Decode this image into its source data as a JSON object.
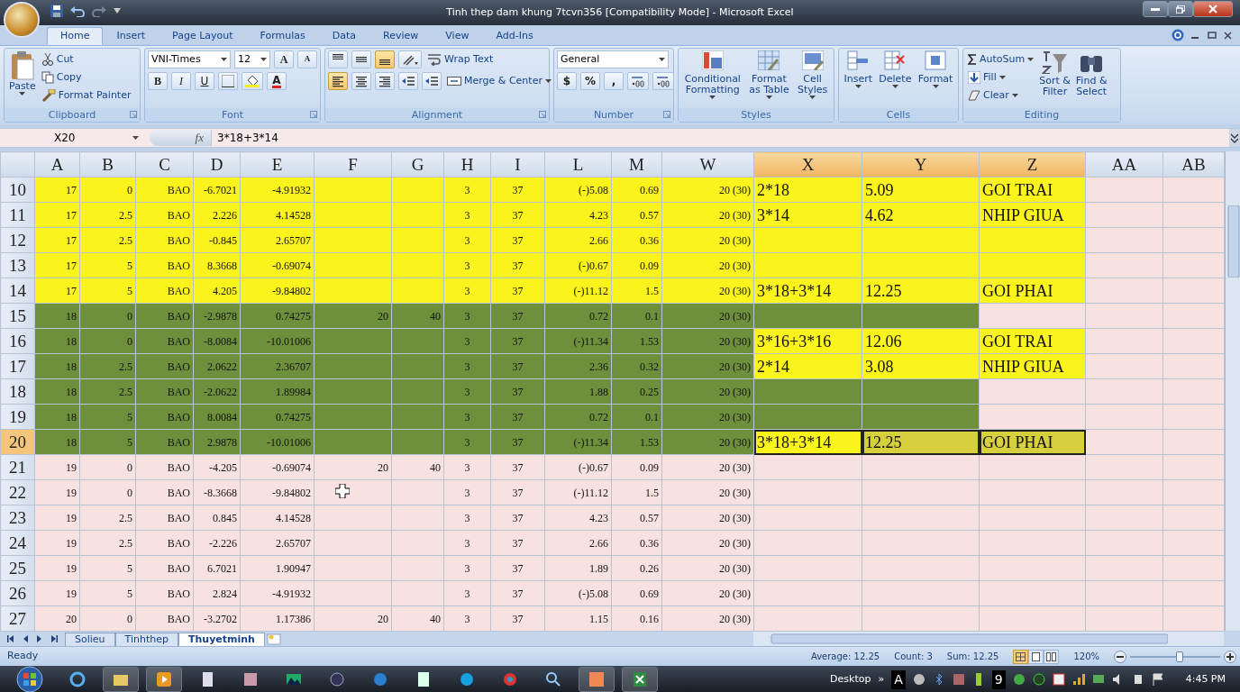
{
  "window": {
    "title": "Tinh thep dam khung 7tcvn356  [Compatibility Mode] - Microsoft Excel"
  },
  "ribbon_tabs": [
    {
      "label": "Home",
      "selected": true
    },
    {
      "label": "Insert",
      "selected": false
    },
    {
      "label": "Page Layout",
      "selected": false
    },
    {
      "label": "Formulas",
      "selected": false
    },
    {
      "label": "Data",
      "selected": false
    },
    {
      "label": "Review",
      "selected": false
    },
    {
      "label": "View",
      "selected": false
    },
    {
      "label": "Add-Ins",
      "selected": false
    }
  ],
  "clipboard": {
    "label": "Clipboard",
    "paste": "Paste",
    "cut": "Cut",
    "copy": "Copy",
    "format_painter": "Format Painter"
  },
  "font": {
    "label": "Font",
    "name": "VNI-Times",
    "size": "12",
    "grow": "A",
    "shrink": "A",
    "bold": "B",
    "italic": "I",
    "underline": "U",
    "font_color_glyph": "A"
  },
  "alignment": {
    "label": "Alignment",
    "vertical": [
      {
        "selected": false
      },
      {
        "selected": false
      },
      {
        "selected": true
      }
    ],
    "horizontal": [
      {
        "selected": true
      },
      {
        "selected": false
      },
      {
        "selected": false
      }
    ],
    "wrap_text": "Wrap Text",
    "merge_center": "Merge & Center"
  },
  "number": {
    "label": "Number",
    "format": "General",
    "currency": "$",
    "percent": "%",
    "comma": ","
  },
  "styles": {
    "label": "Styles",
    "buttons": [
      "Conditional\nFormatting",
      "Format\nas Table",
      "Cell\nStyles"
    ]
  },
  "cells": {
    "label": "Cells",
    "buttons": [
      "Insert",
      "Delete",
      "Format"
    ]
  },
  "editing": {
    "label": "Editing",
    "autosum": "AutoSum",
    "fill": "Fill",
    "clear": "Clear",
    "sort": "Sort &\nFilter",
    "find": "Find &\nSelect"
  },
  "formula_bar": {
    "name_box": "X20",
    "function_label": "fx",
    "formula": "3*18+3*14"
  },
  "columns": [
    {
      "label": "A",
      "selected": false
    },
    {
      "label": "B",
      "selected": false
    },
    {
      "label": "C",
      "selected": false
    },
    {
      "label": "D",
      "selected": false
    },
    {
      "label": "E",
      "selected": false
    },
    {
      "label": "F",
      "selected": false
    },
    {
      "label": "G",
      "selected": false
    },
    {
      "label": "H",
      "selected": false
    },
    {
      "label": "I",
      "selected": false
    },
    {
      "label": "L",
      "selected": false
    },
    {
      "label": "M",
      "selected": false
    },
    {
      "label": "W",
      "selected": false
    },
    {
      "label": "X",
      "selected": true
    },
    {
      "label": "Y",
      "selected": true
    },
    {
      "label": "Z",
      "selected": true
    },
    {
      "label": "AA",
      "selected": false
    },
    {
      "label": "AB",
      "selected": false
    }
  ],
  "rows": [
    {
      "header": "10",
      "selected": false,
      "color": "#fbf31c",
      "cells": {
        "a": "17",
        "b": "0",
        "c": "BAO",
        "d": "-6.7021",
        "e": "-4.91932",
        "h": "3",
        "i": "37",
        "l": "(-)5.08",
        "m": "0.69",
        "w": "20 (30)"
      },
      "extra": [
        {
          "text": "2*18",
          "color": "#fbf31c",
          "selected": false
        },
        {
          "text": "5.09",
          "color": "#fbf31c",
          "selected": false
        },
        {
          "text": "GOI TRAI",
          "color": "#fbf31c",
          "selected": false
        }
      ]
    },
    {
      "header": "11",
      "selected": false,
      "color": "#fbf31c",
      "cells": {
        "a": "17",
        "b": "2.5",
        "c": "BAO",
        "d": "2.226",
        "e": "4.14528",
        "h": "3",
        "i": "37",
        "l": "4.23",
        "m": "0.57",
        "w": "20 (30)"
      },
      "extra": [
        {
          "text": "3*14",
          "color": "#fbf31c",
          "selected": false
        },
        {
          "text": "4.62",
          "color": "#fbf31c",
          "selected": false
        },
        {
          "text": "NHIP GIUA",
          "color": "#fbf31c",
          "selected": false
        }
      ]
    },
    {
      "header": "12",
      "selected": false,
      "color": "#fbf31c",
      "cells": {
        "a": "17",
        "b": "2.5",
        "c": "BAO",
        "d": "-0.845",
        "e": "2.65707",
        "h": "3",
        "i": "37",
        "l": "2.66",
        "m": "0.36",
        "w": "20 (30)"
      },
      "extra": [
        {
          "color": "#fbf31c",
          "selected": false
        },
        {
          "color": "#fbf31c",
          "selected": false
        },
        {
          "color": "#fbf31c",
          "selected": false
        }
      ]
    },
    {
      "header": "13",
      "selected": false,
      "color": "#fbf31c",
      "cells": {
        "a": "17",
        "b": "5",
        "c": "BAO",
        "d": "8.3668",
        "e": "-0.69074",
        "h": "3",
        "i": "37",
        "l": "(-)0.67",
        "m": "0.09",
        "w": "20 (30)"
      },
      "extra": [
        {
          "color": "#fbf31c",
          "selected": false
        },
        {
          "color": "#fbf31c",
          "selected": false
        },
        {
          "color": "#fbf31c",
          "selected": false
        }
      ]
    },
    {
      "header": "14",
      "selected": false,
      "color": "#fbf31c",
      "cells": {
        "a": "17",
        "b": "5",
        "c": "BAO",
        "d": "4.205",
        "e": "-9.84802",
        "h": "3",
        "i": "37",
        "l": "(-)11.12",
        "m": "1.5",
        "w": "20 (30)"
      },
      "extra": [
        {
          "text": "3*18+3*14",
          "color": "#fbf31c",
          "selected": false
        },
        {
          "text": "12.25",
          "color": "#fbf31c",
          "selected": false
        },
        {
          "text": "GOI PHAI",
          "color": "#fbf31c",
          "selected": false
        }
      ]
    },
    {
      "header": "15",
      "selected": false,
      "color": "#6e8f3c",
      "cells": {
        "a": "18",
        "b": "0",
        "c": "BAO",
        "d": "-2.9878",
        "e": "0.74275",
        "f": "20",
        "g": "40",
        "h": "3",
        "i": "37",
        "l": "0.72",
        "m": "0.1",
        "w": "20 (30)"
      },
      "extra": [
        {
          "color": "#6e8f3c",
          "selected": false
        },
        {
          "color": "#6e8f3c",
          "selected": false
        },
        {
          "color": "#f8e1e1",
          "selected": false
        }
      ]
    },
    {
      "header": "16",
      "selected": false,
      "color": "#6e8f3c",
      "cells": {
        "a": "18",
        "b": "0",
        "c": "BAO",
        "d": "-8.0084",
        "e": "-10.01006",
        "h": "3",
        "i": "37",
        "l": "(-)11.34",
        "m": "1.53",
        "w": "20 (30)"
      },
      "extra": [
        {
          "text": "3*16+3*16",
          "color": "#fbf31c",
          "selected": false
        },
        {
          "text": "12.06",
          "color": "#fbf31c",
          "selected": false
        },
        {
          "text": "GOI TRAI",
          "color": "#fbf31c",
          "selected": false
        }
      ]
    },
    {
      "header": "17",
      "selected": false,
      "color": "#6e8f3c",
      "cells": {
        "a": "18",
        "b": "2.5",
        "c": "BAO",
        "d": "2.0622",
        "e": "2.36707",
        "h": "3",
        "i": "37",
        "l": "2.36",
        "m": "0.32",
        "w": "20 (30)"
      },
      "extra": [
        {
          "text": "2*14",
          "color": "#fbf31c",
          "selected": false
        },
        {
          "text": "3.08",
          "color": "#fbf31c",
          "selected": false
        },
        {
          "text": "NHIP GIUA",
          "color": "#fbf31c",
          "selected": false
        }
      ]
    },
    {
      "header": "18",
      "selected": false,
      "color": "#6e8f3c",
      "cells": {
        "a": "18",
        "b": "2.5",
        "c": "BAO",
        "d": "-2.0622",
        "e": "1.89984",
        "h": "3",
        "i": "37",
        "l": "1.88",
        "m": "0.25",
        "w": "20 (30)"
      },
      "extra": [
        {
          "color": "#6e8f3c",
          "selected": false
        },
        {
          "color": "#6e8f3c",
          "selected": false
        },
        {
          "color": "#f8e1e1",
          "selected": false
        }
      ]
    },
    {
      "header": "19",
      "selected": false,
      "color": "#6e8f3c",
      "cells": {
        "a": "18",
        "b": "5",
        "c": "BAO",
        "d": "8.0084",
        "e": "0.74275",
        "h": "3",
        "i": "37",
        "l": "0.72",
        "m": "0.1",
        "w": "20 (30)"
      },
      "extra": [
        {
          "color": "#6e8f3c",
          "selected": false
        },
        {
          "color": "#6e8f3c",
          "selected": false
        },
        {
          "color": "#f8e1e1",
          "selected": false
        }
      ]
    },
    {
      "header": "20",
      "selected": true,
      "color": "#6e8f3c",
      "cells": {
        "a": "18",
        "b": "5",
        "c": "BAO",
        "d": "2.9878",
        "e": "-10.01006",
        "h": "3",
        "i": "37",
        "l": "(-)11.34",
        "m": "1.53",
        "w": "20 (30)"
      },
      "extra": [
        {
          "text": "3*18+3*14",
          "color": "#fbf31c",
          "selected": true
        },
        {
          "text": "12.25",
          "color": "#d6cf3e",
          "selected": true
        },
        {
          "text": "GOI PHAI",
          "color": "#d6cf3e",
          "selected": true
        }
      ]
    },
    {
      "header": "21",
      "selected": false,
      "color": "#f8e1e1",
      "cells": {
        "a": "19",
        "b": "0",
        "c": "BAO",
        "d": "-4.205",
        "e": "-0.69074",
        "f": "20",
        "g": "40",
        "h": "3",
        "i": "37",
        "l": "(-)0.67",
        "m": "0.09",
        "w": "20 (30)"
      },
      "extra": [
        {
          "color": "#f8e1e1",
          "selected": false
        },
        {
          "color": "#f8e1e1",
          "selected": false
        },
        {
          "color": "#f8e1e1",
          "selected": false
        }
      ]
    },
    {
      "header": "22",
      "selected": false,
      "color": "#f8e1e1",
      "cells": {
        "a": "19",
        "b": "0",
        "c": "BAO",
        "d": "-8.3668",
        "e": "-9.84802",
        "h": "3",
        "i": "37",
        "l": "(-)11.12",
        "m": "1.5",
        "w": "20 (30)"
      },
      "extra": [
        {
          "color": "#f8e1e1",
          "selected": false
        },
        {
          "color": "#f8e1e1",
          "selected": false
        },
        {
          "color": "#f8e1e1",
          "selected": false
        }
      ]
    },
    {
      "header": "23",
      "selected": false,
      "color": "#f8e1e1",
      "cells": {
        "a": "19",
        "b": "2.5",
        "c": "BAO",
        "d": "0.845",
        "e": "4.14528",
        "h": "3",
        "i": "37",
        "l": "4.23",
        "m": "0.57",
        "w": "20 (30)"
      },
      "extra": [
        {
          "color": "#f8e1e1",
          "selected": false
        },
        {
          "color": "#f8e1e1",
          "selected": false
        },
        {
          "color": "#f8e1e1",
          "selected": false
        }
      ]
    },
    {
      "header": "24",
      "selected": false,
      "color": "#f8e1e1",
      "cells": {
        "a": "19",
        "b": "2.5",
        "c": "BAO",
        "d": "-2.226",
        "e": "2.65707",
        "h": "3",
        "i": "37",
        "l": "2.66",
        "m": "0.36",
        "w": "20 (30)"
      },
      "extra": [
        {
          "color": "#f8e1e1",
          "selected": false
        },
        {
          "color": "#f8e1e1",
          "selected": false
        },
        {
          "color": "#f8e1e1",
          "selected": false
        }
      ]
    },
    {
      "header": "25",
      "selected": false,
      "color": "#f8e1e1",
      "cells": {
        "a": "19",
        "b": "5",
        "c": "BAO",
        "d": "6.7021",
        "e": "1.90947",
        "h": "3",
        "i": "37",
        "l": "1.89",
        "m": "0.26",
        "w": "20 (30)"
      },
      "extra": [
        {
          "color": "#f8e1e1",
          "selected": false
        },
        {
          "color": "#f8e1e1",
          "selected": false
        },
        {
          "color": "#f8e1e1",
          "selected": false
        }
      ]
    },
    {
      "header": "26",
      "selected": false,
      "color": "#f8e1e1",
      "cells": {
        "a": "19",
        "b": "5",
        "c": "BAO",
        "d": "2.824",
        "e": "-4.91932",
        "h": "3",
        "i": "37",
        "l": "(-)5.08",
        "m": "0.69",
        "w": "20 (30)"
      },
      "extra": [
        {
          "color": "#f8e1e1",
          "selected": false
        },
        {
          "color": "#f8e1e1",
          "selected": false
        },
        {
          "color": "#f8e1e1",
          "selected": false
        }
      ]
    },
    {
      "header": "27",
      "selected": false,
      "color": "#f8e1e1",
      "cells": {
        "a": "20",
        "b": "0",
        "c": "BAO",
        "d": "-3.2702",
        "e": "1.17386",
        "f": "20",
        "g": "40",
        "h": "3",
        "i": "37",
        "l": "1.15",
        "m": "0.16",
        "w": "20 (30)"
      },
      "extra": [
        {
          "color": "#f8e1e1",
          "selected": false
        },
        {
          "color": "#f8e1e1",
          "selected": false
        },
        {
          "color": "#f8e1e1",
          "selected": false
        }
      ]
    }
  ],
  "sheet_tabs": [
    {
      "label": "Solieu",
      "selected": false
    },
    {
      "label": "Tinhthep",
      "selected": false
    },
    {
      "label": "Thuyetminh",
      "selected": true
    }
  ],
  "status_bar": {
    "mode": "Ready",
    "average": "Average: 12.25",
    "count": "Count: 3",
    "sum": "Sum: 12.25",
    "views": [
      {
        "selected": true
      },
      {
        "selected": false
      },
      {
        "selected": false
      }
    ],
    "zoom": "120%",
    "zoom_slider": {
      "level": 0.55
    }
  },
  "taskbar": {
    "desktop": "Desktop",
    "chevron": "»",
    "tray_letter": "A",
    "tray_number": "9",
    "clock": "4:45 PM"
  }
}
